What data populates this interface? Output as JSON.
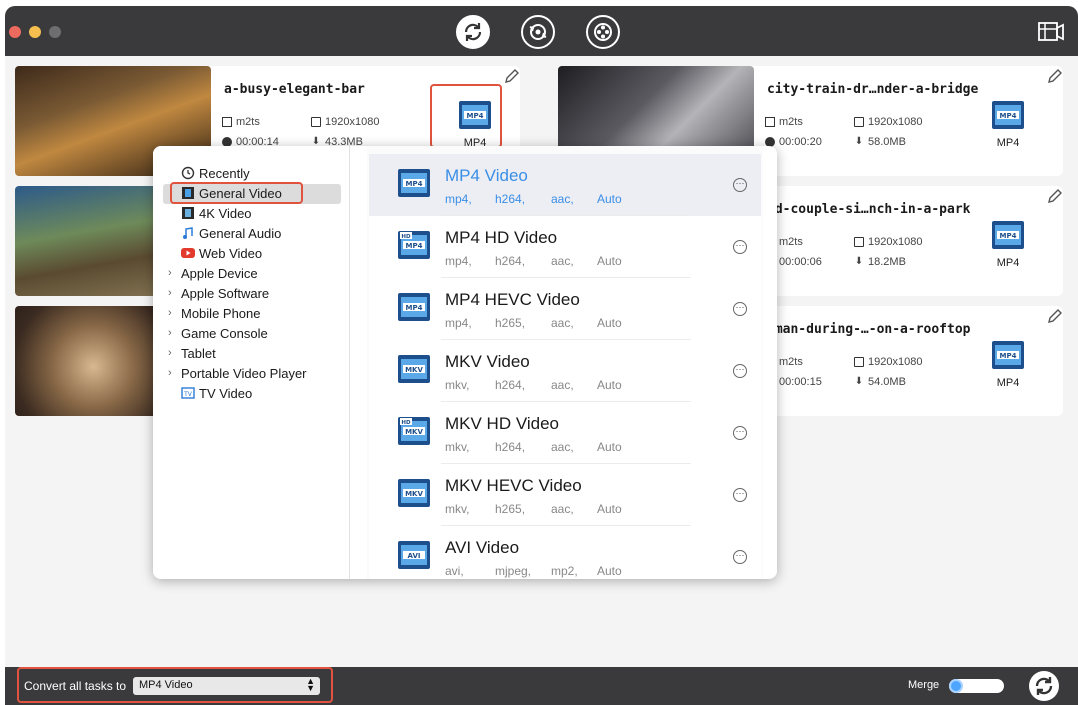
{
  "toolbar": {
    "tools": [
      "convert-icon",
      "compress-icon",
      "toolbox-icon"
    ],
    "corner": "screen-record-icon"
  },
  "tasks": [
    {
      "name": "a-busy-elegant-bar",
      "container": "m2ts",
      "resolution": "1920x1080",
      "duration": "00:00:14",
      "size": "43.3MB",
      "target": "MP4"
    },
    {
      "name": "city-train-dr…nder-a-bridge",
      "container": "m2ts",
      "resolution": "1920x1080",
      "duration": "00:00:20",
      "size": "58.0MB",
      "target": "MP4"
    },
    {
      "name": "ld-couple-si…nch-in-a-park",
      "container": "m2ts",
      "resolution": "1920x1080",
      "duration": "00:00:06",
      "size": "18.2MB",
      "target": "MP4"
    },
    {
      "name": "oman-during-…-on-a-rooftop",
      "container": "m2ts",
      "resolution": "1920x1080",
      "duration": "00:00:15",
      "size": "54.0MB",
      "target": "MP4"
    }
  ],
  "categories": [
    {
      "label": "Recently",
      "icon": "clock-icon",
      "expandable": false
    },
    {
      "label": "General Video",
      "icon": "film-icon",
      "expandable": false,
      "selected": true
    },
    {
      "label": "4K Video",
      "icon": "4k-icon",
      "expandable": false
    },
    {
      "label": "General Audio",
      "icon": "music-note-icon",
      "expandable": false
    },
    {
      "label": "Web Video",
      "icon": "youtube-icon",
      "expandable": false
    },
    {
      "label": "Apple Device",
      "expandable": true
    },
    {
      "label": "Apple Software",
      "expandable": true
    },
    {
      "label": "Mobile Phone",
      "expandable": true
    },
    {
      "label": "Game Console",
      "expandable": true
    },
    {
      "label": "Tablet",
      "expandable": true
    },
    {
      "label": "Portable Video Player",
      "expandable": true
    },
    {
      "label": "TV Video",
      "icon": "tv-icon",
      "expandable": false
    }
  ],
  "formats": [
    {
      "title": "MP4 Video",
      "badge": "MP4",
      "hd": false,
      "specs": [
        "mp4,",
        "h264,",
        "aac,",
        "Auto"
      ],
      "selected": true
    },
    {
      "title": "MP4 HD Video",
      "badge": "MP4",
      "hd": true,
      "specs": [
        "mp4,",
        "h264,",
        "aac,",
        "Auto"
      ]
    },
    {
      "title": "MP4 HEVC Video",
      "badge": "MP4",
      "hd": false,
      "specs": [
        "mp4,",
        "h265,",
        "aac,",
        "Auto"
      ]
    },
    {
      "title": "MKV Video",
      "badge": "MKV",
      "hd": false,
      "specs": [
        "mkv,",
        "h264,",
        "aac,",
        "Auto"
      ]
    },
    {
      "title": "MKV HD Video",
      "badge": "MKV",
      "hd": true,
      "specs": [
        "mkv,",
        "h264,",
        "aac,",
        "Auto"
      ]
    },
    {
      "title": "MKV HEVC Video",
      "badge": "MKV",
      "hd": false,
      "specs": [
        "mkv,",
        "h265,",
        "aac,",
        "Auto"
      ]
    },
    {
      "title": "AVI Video",
      "badge": "AVI",
      "hd": false,
      "specs": [
        "avi,",
        "mjpeg,",
        "mp2,",
        "Auto"
      ]
    }
  ],
  "bottom": {
    "convert_label": "Convert all tasks to",
    "convert_value": "MP4 Video",
    "merge_label": "Merge"
  },
  "colors": {
    "accent": "#3a8ee6",
    "highlight": "#e0533e",
    "bar": "#3a3a3c"
  }
}
